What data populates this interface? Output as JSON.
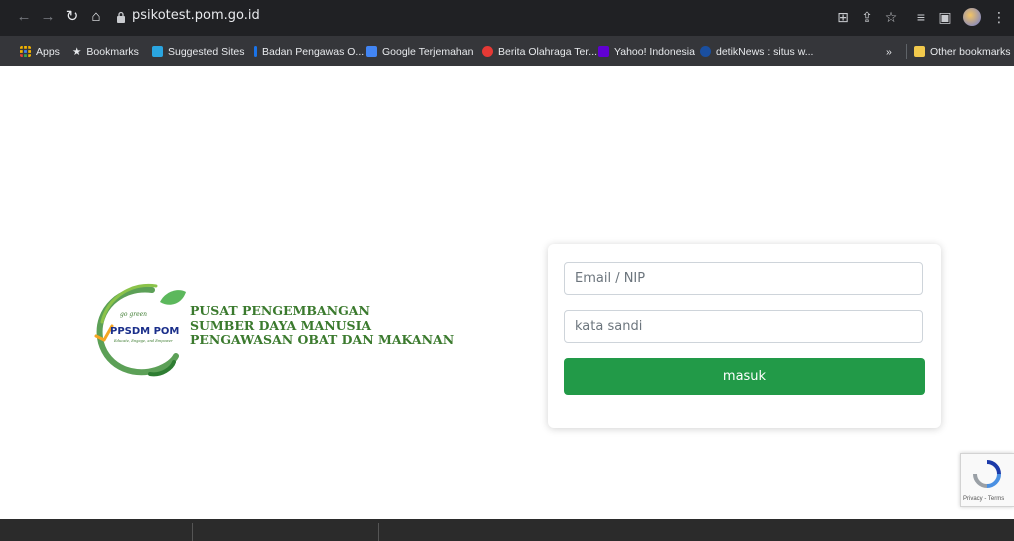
{
  "browser": {
    "url": "psikotest.pom.go.id",
    "bookmarks": [
      {
        "label": "Apps",
        "icon": "apps-grid-icon",
        "color": "#f4b400"
      },
      {
        "label": "Bookmarks",
        "icon": "star-icon",
        "color": "#e8eaed"
      },
      {
        "label": "Suggested Sites",
        "icon": "bing-icon",
        "color": "#2aa5e0"
      },
      {
        "label": "Badan Pengawas O...",
        "icon": "site-favicon-icon",
        "color": "#1a73e8"
      },
      {
        "label": "Google Terjemahan",
        "icon": "translate-icon",
        "color": "#4285f4"
      },
      {
        "label": "Berita Olahraga Ter...",
        "icon": "sports-news-icon",
        "color": "#e53935"
      },
      {
        "label": "Yahoo! Indonesia",
        "icon": "yahoo-icon",
        "color": "#6001d2"
      },
      {
        "label": "detikNews : situs w...",
        "icon": "detik-icon",
        "color": "#1a4fa0"
      }
    ],
    "other_bookmarks": "Other bookmarks",
    "overflow": "»"
  },
  "logo": {
    "wordmark": "PPSDM POM",
    "tagline_top": "go green",
    "tagline_bottom": "Educate, Engage, and Empower",
    "brand_green": "#3b7a2e"
  },
  "org": {
    "line1": "PUSAT PENGEMBANGAN",
    "line2": "SUMBER DAYA MANUSIA",
    "line3": "PENGAWASAN OBAT DAN MAKANAN"
  },
  "login": {
    "email_placeholder": "Email / NIP",
    "password_placeholder": "kata sandi",
    "submit_label": "masuk",
    "button_color": "#229a48"
  },
  "recaptcha": {
    "label": "Privacy - Terms"
  }
}
